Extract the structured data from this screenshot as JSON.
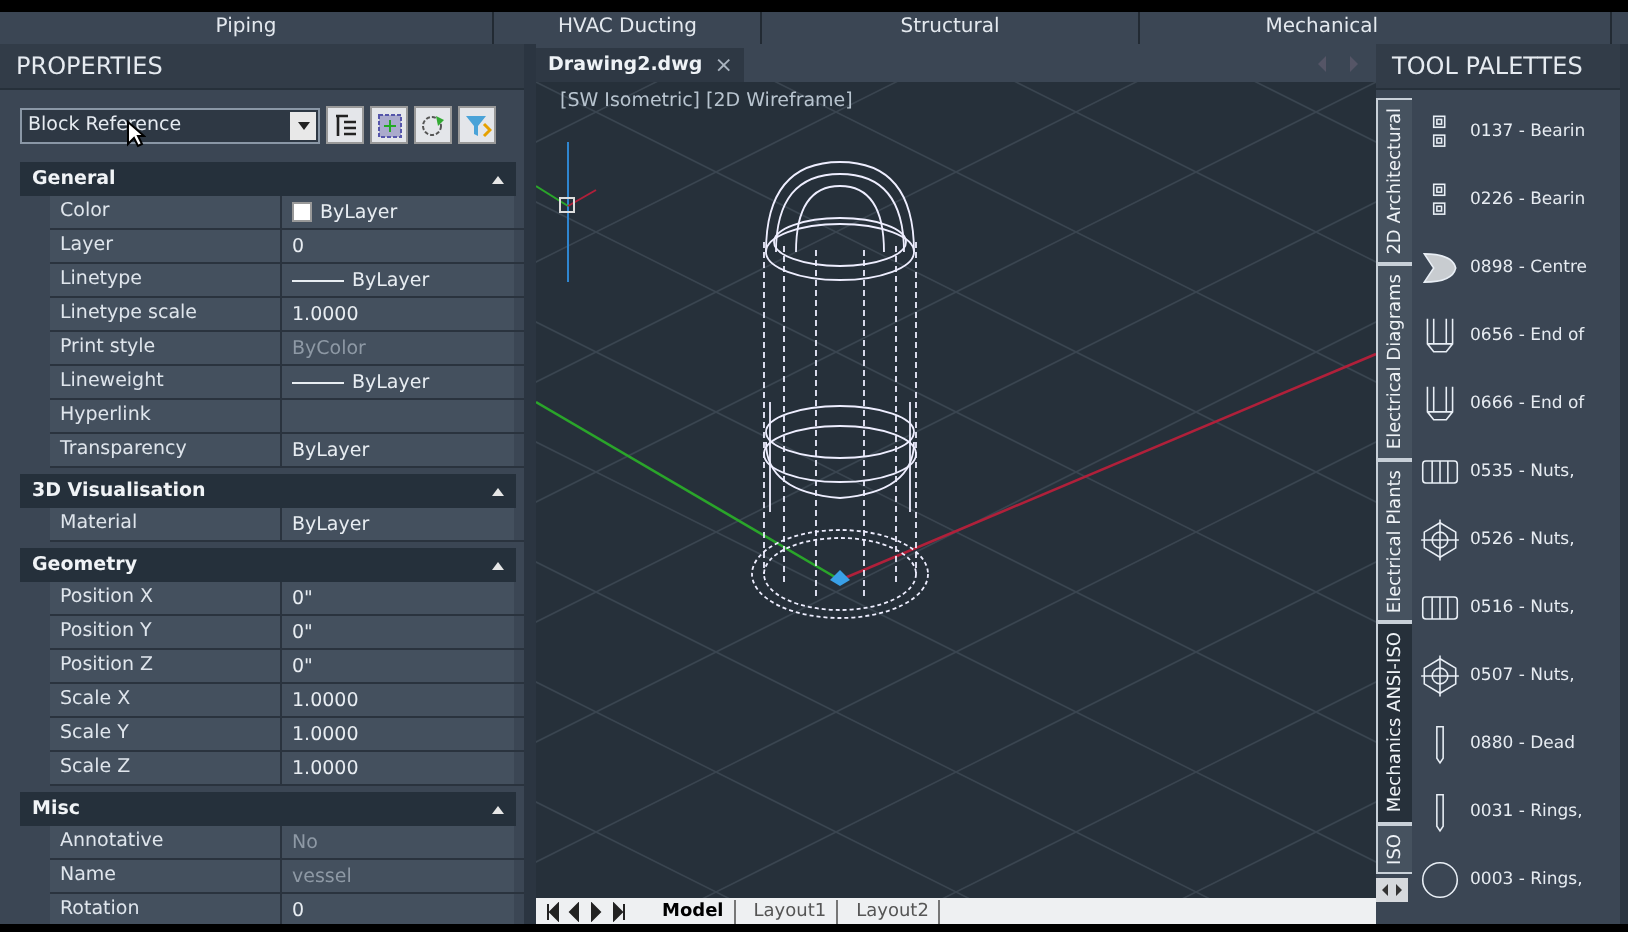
{
  "ribbon_tabs": [
    {
      "label": "Piping"
    },
    {
      "label": "HVAC Ducting"
    },
    {
      "label": "Structural"
    },
    {
      "label": "Mechanical"
    }
  ],
  "properties": {
    "title": "PROPERTIES",
    "selector": {
      "value": "Block Reference"
    },
    "sections": [
      {
        "title": "General",
        "expanded": true,
        "rows": [
          {
            "label": "Color",
            "value": "ByLayer",
            "kind": "swatch",
            "disabled": false
          },
          {
            "label": "Layer",
            "value": "0",
            "kind": "text",
            "disabled": false
          },
          {
            "label": "Linetype",
            "value": "ByLayer",
            "kind": "line",
            "disabled": false
          },
          {
            "label": "Linetype scale",
            "value": "1.0000",
            "kind": "text",
            "disabled": false
          },
          {
            "label": "Print style",
            "value": "ByColor",
            "kind": "text",
            "disabled": true
          },
          {
            "label": "Lineweight",
            "value": "ByLayer",
            "kind": "line",
            "disabled": false
          },
          {
            "label": "Hyperlink",
            "value": "",
            "kind": "text",
            "disabled": false
          },
          {
            "label": "Transparency",
            "value": "ByLayer",
            "kind": "text",
            "disabled": false
          }
        ]
      },
      {
        "title": "3D Visualisation",
        "expanded": true,
        "rows": [
          {
            "label": "Material",
            "value": "ByLayer",
            "kind": "text",
            "disabled": false
          }
        ]
      },
      {
        "title": "Geometry",
        "expanded": true,
        "rows": [
          {
            "label": "Position X",
            "value": "0\"",
            "kind": "text",
            "disabled": false
          },
          {
            "label": "Position Y",
            "value": "0\"",
            "kind": "text",
            "disabled": false
          },
          {
            "label": "Position Z",
            "value": "0\"",
            "kind": "text",
            "disabled": false
          },
          {
            "label": "Scale X",
            "value": "1.0000",
            "kind": "text",
            "disabled": false
          },
          {
            "label": "Scale Y",
            "value": "1.0000",
            "kind": "text",
            "disabled": false
          },
          {
            "label": "Scale Z",
            "value": "1.0000",
            "kind": "text",
            "disabled": false
          }
        ]
      },
      {
        "title": "Misc",
        "expanded": true,
        "rows": [
          {
            "label": "Annotative",
            "value": "No",
            "kind": "text",
            "disabled": true
          },
          {
            "label": "Name",
            "value": "vessel",
            "kind": "text",
            "disabled": true
          },
          {
            "label": "Rotation",
            "value": "0",
            "kind": "text",
            "disabled": false
          }
        ]
      }
    ]
  },
  "document_tab": {
    "label": "Drawing2.dwg",
    "close": "×"
  },
  "viewport": {
    "label": "[SW Isometric] [2D Wireframe]"
  },
  "layout_tabs": [
    {
      "label": "Model",
      "selected": true
    },
    {
      "label": "Layout1",
      "selected": false
    },
    {
      "label": "Layout2",
      "selected": false
    }
  ],
  "tool_palettes": {
    "title": "TOOL PALETTES",
    "tabs": [
      {
        "label": "2D Architectural",
        "selected": false
      },
      {
        "label": "Electrical Diagrams",
        "selected": false
      },
      {
        "label": "Electrical Plants",
        "selected": false
      },
      {
        "label": "Mechanics ANSI-ISO",
        "selected": true
      },
      {
        "label": "ISO",
        "selected": false
      }
    ],
    "items": [
      {
        "label": "0137 - Bearin",
        "kind": "bearing"
      },
      {
        "label": "0226 - Bearin",
        "kind": "bearing"
      },
      {
        "label": "0898 - Centre",
        "kind": "centre"
      },
      {
        "label": "0656 - End of",
        "kind": "end"
      },
      {
        "label": "0666 - End of",
        "kind": "end"
      },
      {
        "label": "0535 - Nuts,",
        "kind": "nut-side"
      },
      {
        "label": "0526 - Nuts,",
        "kind": "nut-front"
      },
      {
        "label": "0516 - Nuts,",
        "kind": "nut-side"
      },
      {
        "label": "0507 - Nuts,",
        "kind": "nut-front"
      },
      {
        "label": "0880 - Dead",
        "kind": "pin"
      },
      {
        "label": "0031 - Rings,",
        "kind": "pin"
      },
      {
        "label": "0003 - Rings,",
        "kind": "ring"
      }
    ]
  }
}
